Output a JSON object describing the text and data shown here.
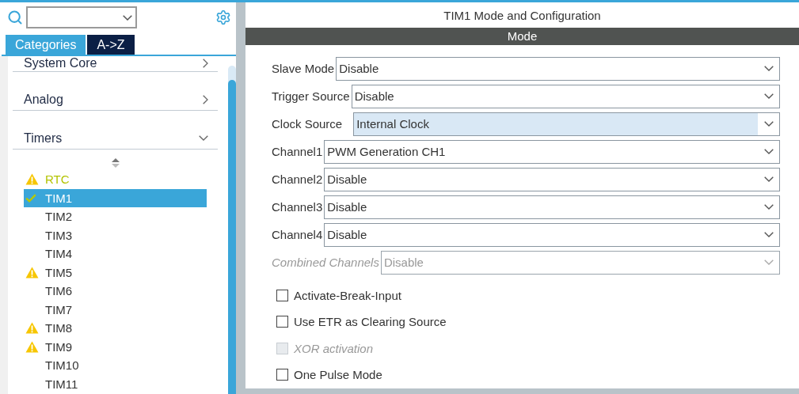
{
  "sidebar": {
    "tabs": [
      {
        "label": "Categories",
        "selected": true
      },
      {
        "label": "A->Z",
        "selected": false
      }
    ],
    "categories": [
      {
        "label": "System Core",
        "expanded": false
      },
      {
        "label": "Analog",
        "expanded": false
      },
      {
        "label": "Timers",
        "expanded": true,
        "children": [
          {
            "label": "RTC",
            "kind": "conflict",
            "selected": false
          },
          {
            "label": "TIM1",
            "kind": "configured",
            "selected": true
          },
          {
            "label": "TIM2",
            "kind": "plain",
            "selected": false
          },
          {
            "label": "TIM3",
            "kind": "plain",
            "selected": false
          },
          {
            "label": "TIM4",
            "kind": "plain",
            "selected": false
          },
          {
            "label": "TIM5",
            "kind": "warning",
            "selected": false
          },
          {
            "label": "TIM6",
            "kind": "plain",
            "selected": false
          },
          {
            "label": "TIM7",
            "kind": "plain",
            "selected": false
          },
          {
            "label": "TIM8",
            "kind": "warning",
            "selected": false
          },
          {
            "label": "TIM9",
            "kind": "warning",
            "selected": false
          },
          {
            "label": "TIM10",
            "kind": "plain",
            "selected": false
          },
          {
            "label": "TIM11",
            "kind": "plain",
            "selected": false
          }
        ]
      }
    ]
  },
  "panel": {
    "title": "TIM1 Mode and Configuration",
    "section": "Mode",
    "fields": [
      {
        "label": "Slave Mode",
        "value": "Disable",
        "disabled": false,
        "focused": false
      },
      {
        "label": "Trigger Source",
        "value": "Disable",
        "disabled": false,
        "focused": false
      },
      {
        "label": "Clock Source",
        "value": "Internal Clock",
        "disabled": false,
        "focused": true
      },
      {
        "label": "Channel1",
        "value": "PWM Generation CH1",
        "disabled": false,
        "focused": false
      },
      {
        "label": "Channel2",
        "value": "Disable",
        "disabled": false,
        "focused": false
      },
      {
        "label": "Channel3",
        "value": "Disable",
        "disabled": false,
        "focused": false
      },
      {
        "label": "Channel4",
        "value": "Disable",
        "disabled": false,
        "focused": false
      },
      {
        "label": "Combined Channels",
        "value": "Disable",
        "disabled": true,
        "focused": false
      }
    ],
    "options": [
      {
        "label": "Activate-Break-Input",
        "checked": false,
        "disabled": false
      },
      {
        "label": "Use ETR as Clearing Source",
        "checked": false,
        "disabled": false
      },
      {
        "label": "XOR activation",
        "checked": false,
        "disabled": true
      },
      {
        "label": "One Pulse Mode",
        "checked": false,
        "disabled": false
      }
    ]
  }
}
